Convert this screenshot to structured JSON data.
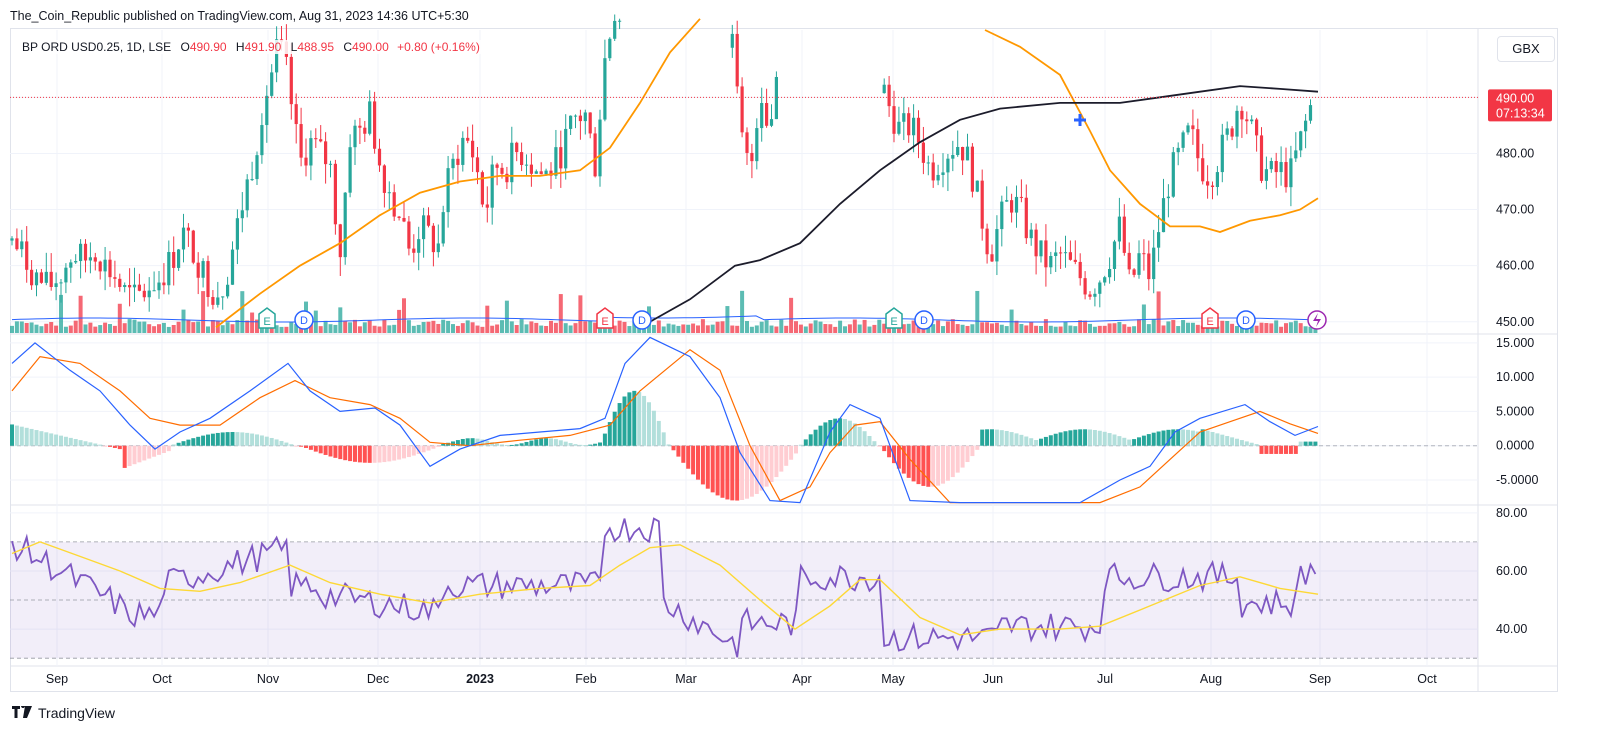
{
  "header": {
    "text": "The_Coin_Republic published on TradingView.com, Aug 31, 2023 14:36 UTC+5:30"
  },
  "legend": {
    "symbol": "BP ORD USD0.25, 1D, LSE",
    "open_label": "O",
    "open": "490.90",
    "high_label": "H",
    "high": "491.90",
    "low_label": "L",
    "low": "488.95",
    "close_label": "C",
    "close": "490.00",
    "change": "+0.80 (+0.16%)"
  },
  "currency": "GBX",
  "price_tag": {
    "price": "490.00",
    "countdown": "07:13:34"
  },
  "footer": {
    "brand": "TradingView"
  },
  "colors": {
    "up": "#26a69a",
    "down": "#f23645",
    "ma_orange": "#ff9800",
    "ma_dark": "#1c1c2b",
    "macd_line": "#2962ff",
    "signal_line": "#ff6d00",
    "rsi_line": "#7e57c2",
    "rsi_ma": "#fdd835",
    "rsi_band": "#7e57c2",
    "volume_ma": "#2962ff"
  },
  "chart_data": [
    {
      "type": "candlestick",
      "name": "price",
      "y_ticks": [
        "450.00",
        "460.00",
        "470.00",
        "480.00",
        "490.00"
      ],
      "ylim": [
        448,
        502
      ],
      "x_ticks": [
        "Sep",
        "Oct",
        "Nov",
        "Dec",
        "2023",
        "Feb",
        "Mar",
        "Apr",
        "May",
        "Jun",
        "Jul",
        "Aug",
        "Sep",
        "Oct"
      ],
      "last_close": 490.0,
      "event_markers": [
        {
          "kind": "E",
          "month": "Nov"
        },
        {
          "kind": "D",
          "month": "Nov"
        },
        {
          "kind": "E",
          "month": "Feb"
        },
        {
          "kind": "D",
          "month": "Feb"
        },
        {
          "kind": "E",
          "month": "May"
        },
        {
          "kind": "D",
          "month": "May"
        },
        {
          "kind": "E",
          "month": "Aug"
        },
        {
          "kind": "D",
          "month": "Aug"
        }
      ],
      "series": [
        {
          "name": "price",
          "points": [
            [
              0,
              463
            ],
            [
              10,
              465
            ],
            [
              22,
              462
            ],
            [
              35,
              458
            ],
            [
              48,
              456
            ],
            [
              60,
              458
            ],
            [
              72,
              462
            ],
            [
              85,
              461
            ],
            [
              95,
              463
            ],
            [
              105,
              460
            ],
            [
              115,
              458
            ],
            [
              125,
              455
            ],
            [
              135,
              454
            ],
            [
              148,
              456
            ],
            [
              160,
              458
            ],
            [
              172,
              461
            ],
            [
              182,
              466
            ],
            [
              195,
              462
            ],
            [
              205,
              458
            ],
            [
              215,
              455
            ],
            [
              225,
              457
            ],
            [
              235,
              465
            ],
            [
              245,
              473
            ],
            [
              255,
              480
            ],
            [
              262,
              488
            ],
            [
              270,
              493
            ],
            [
              278,
              499
            ],
            [
              285,
              496
            ],
            [
              292,
              488
            ],
            [
              300,
              478
            ],
            [
              310,
              482
            ],
            [
              320,
              480
            ],
            [
              330,
              478
            ],
            [
              340,
              462
            ],
            [
              350,
              483
            ],
            [
              360,
              484
            ],
            [
              370,
              487
            ],
            [
              380,
              478
            ],
            [
              392,
              472
            ],
            [
              402,
              468
            ],
            [
              410,
              462
            ],
            [
              420,
              467
            ],
            [
              430,
              465
            ],
            [
              438,
              463
            ],
            [
              445,
              473
            ],
            [
              455,
              479
            ],
            [
              465,
              483
            ],
            [
              475,
              479
            ],
            [
              485,
              469
            ],
            [
              495,
              478
            ],
            [
              505,
              477
            ],
            [
              515,
              480
            ],
            [
              525,
              480
            ],
            [
              535,
              477
            ],
            [
              545,
              476
            ],
            [
              555,
              478
            ],
            [
              565,
              482
            ],
            [
              575,
              486
            ],
            [
              585,
              487
            ],
            [
              595,
              478
            ],
            [
              605,
              497
            ],
            [
              615,
              506
            ],
            [
              622,
              504
            ]
          ]
        },
        {
          "name": "price_b",
          "points": [
            [
              730,
              504
            ],
            [
              740,
              484
            ],
            [
              750,
              476
            ],
            [
              760,
              492
            ],
            [
              770,
              484
            ],
            [
              780,
              500
            ]
          ]
        },
        {
          "name": "price_c",
          "points": [
            [
              880,
              493
            ],
            [
              890,
              488
            ],
            [
              900,
              484
            ],
            [
              910,
              485
            ],
            [
              920,
              482
            ],
            [
              930,
              477
            ],
            [
              940,
              479
            ],
            [
              950,
              481
            ],
            [
              960,
              482
            ],
            [
              970,
              478
            ],
            [
              980,
              470
            ],
            [
              990,
              462
            ],
            [
              1000,
              468
            ],
            [
              1010,
              472
            ],
            [
              1020,
              470
            ],
            [
              1030,
              465
            ],
            [
              1040,
              462
            ],
            [
              1050,
              460
            ],
            [
              1060,
              462
            ],
            [
              1070,
              460
            ],
            [
              1080,
              458
            ],
            [
              1090,
              456
            ],
            [
              1100,
              458
            ],
            [
              1110,
              462
            ],
            [
              1120,
              467
            ],
            [
              1130,
              456
            ],
            [
              1140,
              462
            ],
            [
              1150,
              458
            ],
            [
              1160,
              468
            ],
            [
              1170,
              476
            ],
            [
              1180,
              480
            ],
            [
              1190,
              484
            ],
            [
              1200,
              478
            ],
            [
              1210,
              476
            ],
            [
              1220,
              480
            ],
            [
              1230,
              484
            ],
            [
              1240,
              490
            ],
            [
              1250,
              485
            ],
            [
              1260,
              478
            ],
            [
              1270,
              476
            ],
            [
              1280,
              477
            ],
            [
              1290,
              476
            ],
            [
              1300,
              482
            ],
            [
              1310,
              488
            ],
            [
              1315,
              490
            ]
          ]
        }
      ]
    },
    {
      "type": "bar",
      "name": "MACD",
      "y_ticks": [
        "15.000",
        "10.000",
        "5.0000",
        "0.0000",
        "-5.0000"
      ],
      "ylim": [
        -8.5,
        16
      ]
    },
    {
      "type": "line",
      "name": "RSI",
      "y_ticks": [
        "80.00",
        "60.00",
        "40.00"
      ],
      "ylim": [
        28,
        82
      ],
      "band": [
        30,
        70
      ]
    }
  ]
}
